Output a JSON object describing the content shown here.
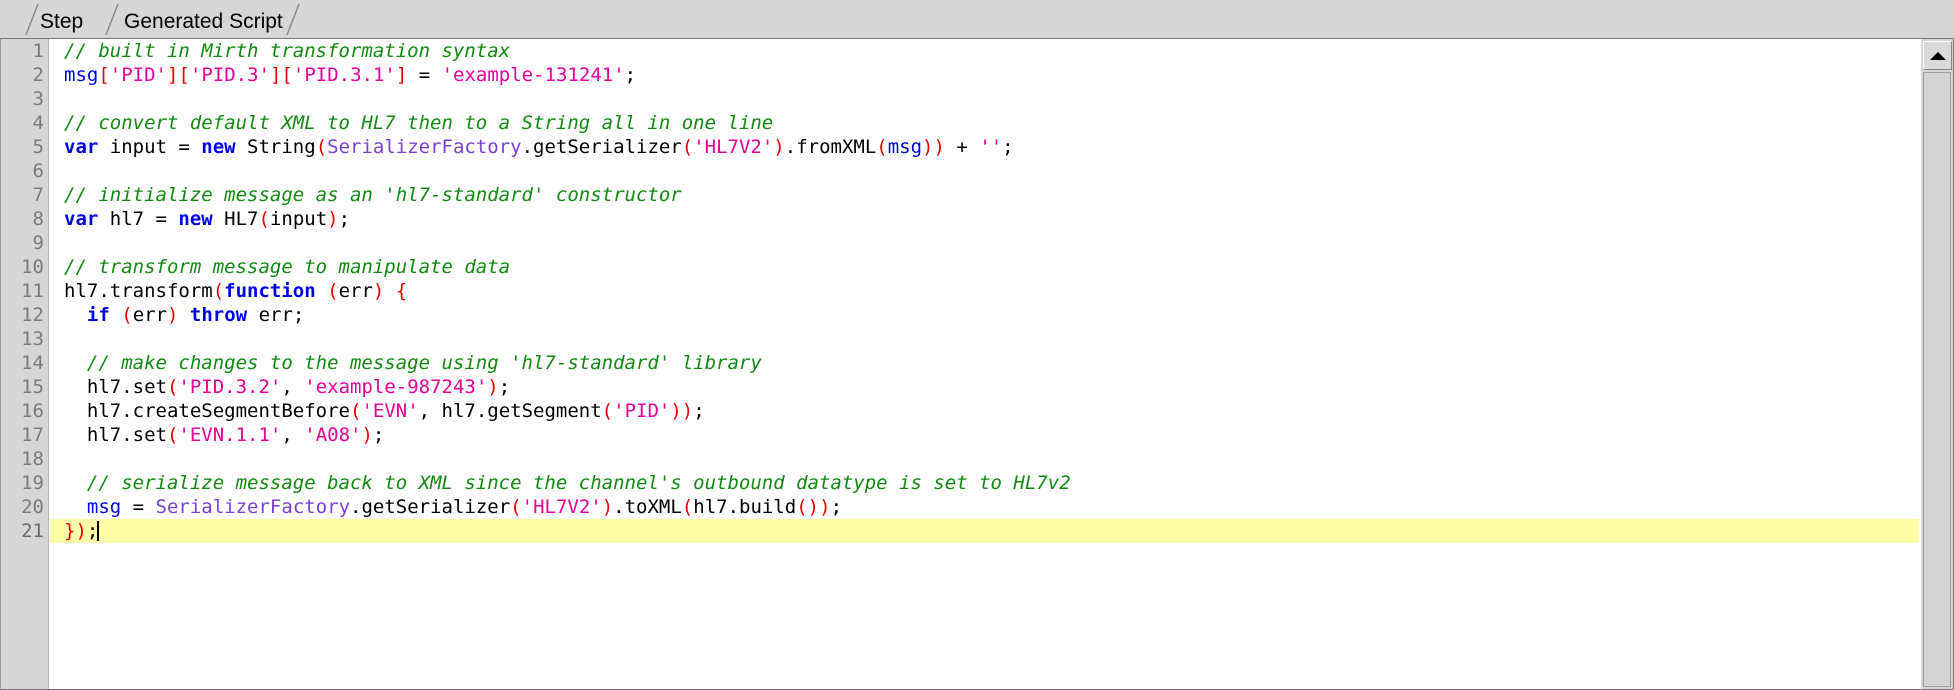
{
  "tabs": [
    {
      "label": "Step",
      "selected": false
    },
    {
      "label": "Generated Script",
      "selected": true
    }
  ],
  "colors": {
    "comment": "#128a12",
    "keyword": "#0000e6",
    "string": "#e6009a",
    "bracket": "#ee0000",
    "class": "#7b3fd6",
    "plain": "#000000",
    "current_line_highlight": "#ffffaa",
    "gutter_bg": "#d6d6d6",
    "editor_bg": "#ffffff"
  },
  "editor": {
    "current_line": 21,
    "total_lines": 21,
    "fold_markers": [
      11
    ],
    "scrollbar": {
      "up_button_icon": "triangle-up-icon",
      "thumb_fills_track": true
    },
    "line_numbers": [
      "1",
      "2",
      "3",
      "4",
      "5",
      "6",
      "7",
      "8",
      "9",
      "10",
      "11",
      "12",
      "13",
      "14",
      "15",
      "16",
      "17",
      "18",
      "19",
      "20",
      "21"
    ],
    "lines": [
      {
        "n": 1,
        "text": "// built in Mirth transformation syntax"
      },
      {
        "n": 2,
        "text": "msg['PID']['PID.3']['PID.3.1'] = 'example-131241';"
      },
      {
        "n": 3,
        "text": ""
      },
      {
        "n": 4,
        "text": "// convert default XML to HL7 then to a String all in one line"
      },
      {
        "n": 5,
        "text": "var input = new String(SerializerFactory.getSerializer('HL7V2').fromXML(msg)) + '';"
      },
      {
        "n": 6,
        "text": ""
      },
      {
        "n": 7,
        "text": "// initialize message as an 'hl7-standard' constructor"
      },
      {
        "n": 8,
        "text": "var hl7 = new HL7(input);"
      },
      {
        "n": 9,
        "text": ""
      },
      {
        "n": 10,
        "text": "// transform message to manipulate data"
      },
      {
        "n": 11,
        "text": "hl7.transform(function (err) {"
      },
      {
        "n": 12,
        "text": "  if (err) throw err;"
      },
      {
        "n": 13,
        "text": ""
      },
      {
        "n": 14,
        "text": "  // make changes to the message using 'hl7-standard' library"
      },
      {
        "n": 15,
        "text": "  hl7.set('PID.3.2', 'example-987243');"
      },
      {
        "n": 16,
        "text": "  hl7.createSegmentBefore('EVN', hl7.getSegment('PID'));"
      },
      {
        "n": 17,
        "text": "  hl7.set('EVN.1.1', 'A08');"
      },
      {
        "n": 18,
        "text": ""
      },
      {
        "n": 19,
        "text": "  // serialize message back to XML since the channel's outbound datatype is set to HL7v2"
      },
      {
        "n": 20,
        "text": "  msg = SerializerFactory.getSerializer('HL7V2').toXML(hl7.build());"
      },
      {
        "n": 21,
        "text": "});"
      }
    ],
    "tokenized_lines": [
      [
        {
          "t": "// built in Mirth transformation syntax",
          "c": "comment"
        }
      ],
      [
        {
          "t": "msg",
          "c": "var"
        },
        {
          "t": "[",
          "c": "bracket"
        },
        {
          "t": "'PID'",
          "c": "string"
        },
        {
          "t": "]",
          "c": "bracket"
        },
        {
          "t": "[",
          "c": "bracket"
        },
        {
          "t": "'PID.3'",
          "c": "string"
        },
        {
          "t": "]",
          "c": "bracket"
        },
        {
          "t": "[",
          "c": "bracket"
        },
        {
          "t": "'PID.3.1'",
          "c": "string"
        },
        {
          "t": "]",
          "c": "bracket"
        },
        {
          "t": " = ",
          "c": "plain"
        },
        {
          "t": "'example-131241'",
          "c": "string"
        },
        {
          "t": ";",
          "c": "plain"
        }
      ],
      [],
      [
        {
          "t": "// convert default XML to HL7 then to a String all in one line",
          "c": "comment"
        }
      ],
      [
        {
          "t": "var",
          "c": "keyword"
        },
        {
          "t": " input = ",
          "c": "plain"
        },
        {
          "t": "new",
          "c": "keyword"
        },
        {
          "t": " String",
          "c": "plain"
        },
        {
          "t": "(",
          "c": "bracket"
        },
        {
          "t": "SerializerFactory",
          "c": "class"
        },
        {
          "t": ".getSerializer",
          "c": "plain"
        },
        {
          "t": "(",
          "c": "bracket"
        },
        {
          "t": "'HL7V2'",
          "c": "string"
        },
        {
          "t": ")",
          "c": "bracket"
        },
        {
          "t": ".fromXML",
          "c": "plain"
        },
        {
          "t": "(",
          "c": "bracket"
        },
        {
          "t": "msg",
          "c": "var"
        },
        {
          "t": ")",
          "c": "bracket"
        },
        {
          "t": ")",
          "c": "bracket"
        },
        {
          "t": " + ",
          "c": "plain"
        },
        {
          "t": "''",
          "c": "string"
        },
        {
          "t": ";",
          "c": "plain"
        }
      ],
      [],
      [
        {
          "t": "// initialize message as an 'hl7-standard' constructor",
          "c": "comment"
        }
      ],
      [
        {
          "t": "var",
          "c": "keyword"
        },
        {
          "t": " hl7 = ",
          "c": "plain"
        },
        {
          "t": "new",
          "c": "keyword"
        },
        {
          "t": " HL7",
          "c": "plain"
        },
        {
          "t": "(",
          "c": "bracket"
        },
        {
          "t": "input",
          "c": "plain"
        },
        {
          "t": ")",
          "c": "bracket"
        },
        {
          "t": ";",
          "c": "plain"
        }
      ],
      [],
      [
        {
          "t": "// transform message to manipulate data",
          "c": "comment"
        }
      ],
      [
        {
          "t": "hl7.transform",
          "c": "plain"
        },
        {
          "t": "(",
          "c": "bracket"
        },
        {
          "t": "function",
          "c": "keyword"
        },
        {
          "t": " ",
          "c": "plain"
        },
        {
          "t": "(",
          "c": "bracket"
        },
        {
          "t": "err",
          "c": "plain"
        },
        {
          "t": ")",
          "c": "bracket"
        },
        {
          "t": " ",
          "c": "plain"
        },
        {
          "t": "{",
          "c": "bracket"
        }
      ],
      [
        {
          "t": "  ",
          "c": "plain"
        },
        {
          "t": "if",
          "c": "keyword"
        },
        {
          "t": " ",
          "c": "plain"
        },
        {
          "t": "(",
          "c": "bracket"
        },
        {
          "t": "err",
          "c": "plain"
        },
        {
          "t": ")",
          "c": "bracket"
        },
        {
          "t": " ",
          "c": "plain"
        },
        {
          "t": "throw",
          "c": "keyword"
        },
        {
          "t": " err;",
          "c": "plain"
        }
      ],
      [],
      [
        {
          "t": "  // make changes to the message using 'hl7-standard' library",
          "c": "comment"
        }
      ],
      [
        {
          "t": "  hl7.set",
          "c": "plain"
        },
        {
          "t": "(",
          "c": "bracket"
        },
        {
          "t": "'PID.3.2'",
          "c": "string"
        },
        {
          "t": ", ",
          "c": "plain"
        },
        {
          "t": "'example-987243'",
          "c": "string"
        },
        {
          "t": ")",
          "c": "bracket"
        },
        {
          "t": ";",
          "c": "plain"
        }
      ],
      [
        {
          "t": "  hl7.createSegmentBefore",
          "c": "plain"
        },
        {
          "t": "(",
          "c": "bracket"
        },
        {
          "t": "'EVN'",
          "c": "string"
        },
        {
          "t": ", hl7.getSegment",
          "c": "plain"
        },
        {
          "t": "(",
          "c": "bracket"
        },
        {
          "t": "'PID'",
          "c": "string"
        },
        {
          "t": ")",
          "c": "bracket"
        },
        {
          "t": ")",
          "c": "bracket"
        },
        {
          "t": ";",
          "c": "plain"
        }
      ],
      [
        {
          "t": "  hl7.set",
          "c": "plain"
        },
        {
          "t": "(",
          "c": "bracket"
        },
        {
          "t": "'EVN.1.1'",
          "c": "string"
        },
        {
          "t": ", ",
          "c": "plain"
        },
        {
          "t": "'A08'",
          "c": "string"
        },
        {
          "t": ")",
          "c": "bracket"
        },
        {
          "t": ";",
          "c": "plain"
        }
      ],
      [],
      [
        {
          "t": "  // serialize message back to XML since the channel's outbound datatype is set to HL7v2",
          "c": "comment"
        }
      ],
      [
        {
          "t": "  ",
          "c": "plain"
        },
        {
          "t": "msg",
          "c": "var"
        },
        {
          "t": " = ",
          "c": "plain"
        },
        {
          "t": "SerializerFactory",
          "c": "class"
        },
        {
          "t": ".getSerializer",
          "c": "plain"
        },
        {
          "t": "(",
          "c": "bracket"
        },
        {
          "t": "'HL7V2'",
          "c": "string"
        },
        {
          "t": ")",
          "c": "bracket"
        },
        {
          "t": ".toXML",
          "c": "plain"
        },
        {
          "t": "(",
          "c": "bracket"
        },
        {
          "t": "hl7.build",
          "c": "plain"
        },
        {
          "t": "(",
          "c": "bracket"
        },
        {
          "t": ")",
          "c": "bracket"
        },
        {
          "t": ")",
          "c": "bracket"
        },
        {
          "t": ";",
          "c": "plain"
        }
      ],
      [
        {
          "t": "}",
          "c": "bracket"
        },
        {
          "t": ")",
          "c": "bracket"
        },
        {
          "t": ";",
          "c": "plain"
        }
      ]
    ]
  }
}
